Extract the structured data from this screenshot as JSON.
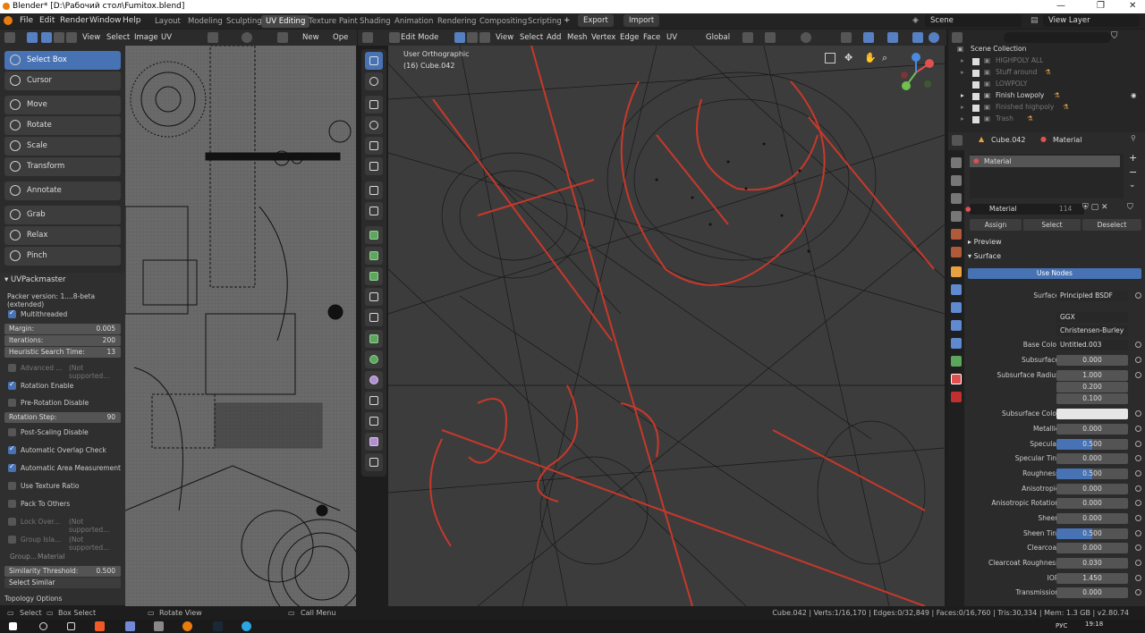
{
  "window": {
    "title": "Blender* [D:\\Рабочий стол\\Fumitox.blend]",
    "minimize": "—",
    "maximize": "❐",
    "close": "✕"
  },
  "menu": {
    "items": [
      "File",
      "Edit",
      "Render",
      "Window",
      "Help"
    ]
  },
  "workspaces": [
    "Layout",
    "Modeling",
    "Sculpting",
    "UV Editing",
    "Texture Paint",
    "Shading",
    "Animation",
    "Rendering",
    "Compositing",
    "Scripting"
  ],
  "active_workspace": "UV Editing",
  "top_right": {
    "export": "Export",
    "import": "Import",
    "scene": "Scene",
    "view_layer": "View Layer"
  },
  "uv_header": {
    "view": "View",
    "select": "Select",
    "image": "Image",
    "uv": "UV",
    "new": "New",
    "open": "Ope"
  },
  "viewport_header": {
    "mode": "Edit Mode",
    "view": "View",
    "select": "Select",
    "add": "Add",
    "mesh": "Mesh",
    "vertex": "Vertex",
    "edge": "Edge",
    "face": "Face",
    "uv": "UV",
    "orientation": "Global"
  },
  "viewport_overlay": {
    "view_name": "User Orthographic",
    "object": "(16) Cube.042"
  },
  "tools": [
    {
      "label": "Select Box",
      "selected": true
    },
    {
      "label": "Cursor"
    },
    {
      "label": "Move"
    },
    {
      "label": "Rotate"
    },
    {
      "label": "Scale"
    },
    {
      "label": "Transform"
    },
    {
      "label": "Annotate"
    },
    {
      "label": "Grab"
    },
    {
      "label": "Relax"
    },
    {
      "label": "Pinch"
    }
  ],
  "uvpackmaster": {
    "title": "UVPackmaster",
    "version": "Packer version: 1....8-beta (extended)",
    "multithreaded": "Multithreaded",
    "margin_label": "Margin:",
    "margin": "0.005",
    "iterations_label": "Iterations:",
    "iterations": "200",
    "heuristic_label": "Heuristic Search Time:",
    "heuristic": "13",
    "advanced": "Advanced ...",
    "not_supported": "(Not supported...",
    "rotation_enable": "Rotation Enable",
    "pre_rotation": "Pre-Rotation Disable",
    "rotation_step_label": "Rotation Step:",
    "rotation_step": "90",
    "post_scaling": "Post-Scaling Disable",
    "overlap_check": "Automatic Overlap Check",
    "area_measurement": "Automatic Area Measurement",
    "texture_ratio": "Use Texture Ratio",
    "pack_to_others": "Pack To Others",
    "lock_over": "Lock Over...",
    "group_isla": "Group Isla...",
    "group_label": "Group...",
    "group_value": "Material",
    "similarity_label": "Similarity Threshold:",
    "similarity": "0.500",
    "select_similar": "Select Similar",
    "topology": "Topology Options"
  },
  "outliner": {
    "root": "Scene Collection",
    "items": [
      {
        "name": "HIGHPOLY ALL",
        "dim": true
      },
      {
        "name": "Stuff around",
        "dim": true
      },
      {
        "name": "LOWPOLY",
        "dim": true
      },
      {
        "name": "Finish Lowpoly",
        "dim": false
      },
      {
        "name": "Finished highpoly",
        "dim": true
      },
      {
        "name": "Trash",
        "dim": true
      }
    ]
  },
  "properties": {
    "object": "Cube.042",
    "material_tab": "Material",
    "slot": "Material",
    "mat_name": "Material",
    "users": "114",
    "assign": "Assign",
    "select": "Select",
    "deselect": "Deselect",
    "preview": "Preview",
    "surface_panel": "Surface",
    "use_nodes": "Use Nodes",
    "rows": [
      {
        "label": "Surface",
        "value": "Principled BSDF",
        "style": "drop"
      },
      {
        "label": "",
        "value": "GGX",
        "style": "drop"
      },
      {
        "label": "",
        "value": "Christensen-Burley",
        "style": "drop"
      },
      {
        "label": "Base Color",
        "value": "Untitled.003",
        "style": "drop"
      },
      {
        "label": "Subsurface",
        "value": "0.000",
        "style": ""
      },
      {
        "label": "Subsurface Radius",
        "value": "1.000",
        "style": ""
      },
      {
        "label": "",
        "value": "0.200",
        "style": ""
      },
      {
        "label": "",
        "value": "0.100",
        "style": ""
      },
      {
        "label": "Subsurface Color",
        "value": "",
        "style": "white"
      },
      {
        "label": "Metallic",
        "value": "0.000",
        "style": ""
      },
      {
        "label": "Specular",
        "value": "0.500",
        "style": "blue half"
      },
      {
        "label": "Specular Tint",
        "value": "0.000",
        "style": ""
      },
      {
        "label": "Roughness",
        "value": "0.500",
        "style": "blue half"
      },
      {
        "label": "Anisotropic",
        "value": "0.000",
        "style": ""
      },
      {
        "label": "Anisotropic Rotation",
        "value": "0.000",
        "style": ""
      },
      {
        "label": "Sheen",
        "value": "0.000",
        "style": ""
      },
      {
        "label": "Sheen Tint",
        "value": "0.500",
        "style": "blue half"
      },
      {
        "label": "Clearcoat",
        "value": "0.000",
        "style": ""
      },
      {
        "label": "Clearcoat Roughness",
        "value": "0.030",
        "style": ""
      },
      {
        "label": "IOR",
        "value": "1.450",
        "style": ""
      },
      {
        "label": "Transmission",
        "value": "0.000",
        "style": ""
      }
    ]
  },
  "status": {
    "select": "Select",
    "box_select": "Box Select",
    "rotate_view": "Rotate View",
    "call_menu": "Call Menu",
    "stats": "Cube.042 | Verts:1/16,170 | Edges:0/32,849 | Faces:0/16,760 | Tris:30,334 | Mem: 1.3 GB | v2.80.74"
  },
  "taskbar": {
    "lang": "РУС",
    "time": "19:18"
  },
  "colors": {
    "accent": "#4772b3",
    "wire_red": "#d03a2a",
    "orange": "#e87d0d"
  }
}
